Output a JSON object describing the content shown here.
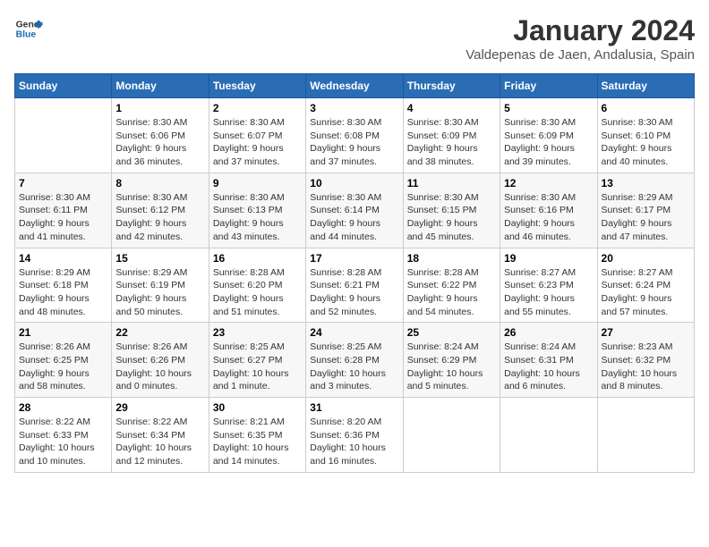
{
  "header": {
    "logo_general": "General",
    "logo_blue": "Blue",
    "month_title": "January 2024",
    "subtitle": "Valdepenas de Jaen, Andalusia, Spain"
  },
  "days_of_week": [
    "Sunday",
    "Monday",
    "Tuesday",
    "Wednesday",
    "Thursday",
    "Friday",
    "Saturday"
  ],
  "weeks": [
    [
      {
        "day": "",
        "content": ""
      },
      {
        "day": "1",
        "content": "Sunrise: 8:30 AM\nSunset: 6:06 PM\nDaylight: 9 hours\nand 36 minutes."
      },
      {
        "day": "2",
        "content": "Sunrise: 8:30 AM\nSunset: 6:07 PM\nDaylight: 9 hours\nand 37 minutes."
      },
      {
        "day": "3",
        "content": "Sunrise: 8:30 AM\nSunset: 6:08 PM\nDaylight: 9 hours\nand 37 minutes."
      },
      {
        "day": "4",
        "content": "Sunrise: 8:30 AM\nSunset: 6:09 PM\nDaylight: 9 hours\nand 38 minutes."
      },
      {
        "day": "5",
        "content": "Sunrise: 8:30 AM\nSunset: 6:09 PM\nDaylight: 9 hours\nand 39 minutes."
      },
      {
        "day": "6",
        "content": "Sunrise: 8:30 AM\nSunset: 6:10 PM\nDaylight: 9 hours\nand 40 minutes."
      }
    ],
    [
      {
        "day": "7",
        "content": ""
      },
      {
        "day": "8",
        "content": "Sunrise: 8:30 AM\nSunset: 6:12 PM\nDaylight: 9 hours\nand 42 minutes."
      },
      {
        "day": "9",
        "content": "Sunrise: 8:30 AM\nSunset: 6:13 PM\nDaylight: 9 hours\nand 43 minutes."
      },
      {
        "day": "10",
        "content": "Sunrise: 8:30 AM\nSunset: 6:14 PM\nDaylight: 9 hours\nand 44 minutes."
      },
      {
        "day": "11",
        "content": "Sunrise: 8:30 AM\nSunset: 6:15 PM\nDaylight: 9 hours\nand 45 minutes."
      },
      {
        "day": "12",
        "content": "Sunrise: 8:30 AM\nSunset: 6:16 PM\nDaylight: 9 hours\nand 46 minutes."
      },
      {
        "day": "13",
        "content": "Sunrise: 8:29 AM\nSunset: 6:17 PM\nDaylight: 9 hours\nand 47 minutes."
      }
    ],
    [
      {
        "day": "14",
        "content": ""
      },
      {
        "day": "15",
        "content": "Sunrise: 8:29 AM\nSunset: 6:19 PM\nDaylight: 9 hours\nand 50 minutes."
      },
      {
        "day": "16",
        "content": "Sunrise: 8:28 AM\nSunset: 6:20 PM\nDaylight: 9 hours\nand 51 minutes."
      },
      {
        "day": "17",
        "content": "Sunrise: 8:28 AM\nSunset: 6:21 PM\nDaylight: 9 hours\nand 52 minutes."
      },
      {
        "day": "18",
        "content": "Sunrise: 8:28 AM\nSunset: 6:22 PM\nDaylight: 9 hours\nand 54 minutes."
      },
      {
        "day": "19",
        "content": "Sunrise: 8:27 AM\nSunset: 6:23 PM\nDaylight: 9 hours\nand 55 minutes."
      },
      {
        "day": "20",
        "content": "Sunrise: 8:27 AM\nSunset: 6:24 PM\nDaylight: 9 hours\nand 57 minutes."
      }
    ],
    [
      {
        "day": "21",
        "content": ""
      },
      {
        "day": "22",
        "content": "Sunrise: 8:26 AM\nSunset: 6:26 PM\nDaylight: 10 hours\nand 0 minutes."
      },
      {
        "day": "23",
        "content": "Sunrise: 8:25 AM\nSunset: 6:27 PM\nDaylight: 10 hours\nand 1 minute."
      },
      {
        "day": "24",
        "content": "Sunrise: 8:25 AM\nSunset: 6:28 PM\nDaylight: 10 hours\nand 3 minutes."
      },
      {
        "day": "25",
        "content": "Sunrise: 8:24 AM\nSunset: 6:29 PM\nDaylight: 10 hours\nand 5 minutes."
      },
      {
        "day": "26",
        "content": "Sunrise: 8:24 AM\nSunset: 6:31 PM\nDaylight: 10 hours\nand 6 minutes."
      },
      {
        "day": "27",
        "content": "Sunrise: 8:23 AM\nSunset: 6:32 PM\nDaylight: 10 hours\nand 8 minutes."
      }
    ],
    [
      {
        "day": "28",
        "content": ""
      },
      {
        "day": "29",
        "content": "Sunrise: 8:22 AM\nSunset: 6:34 PM\nDaylight: 10 hours\nand 12 minutes."
      },
      {
        "day": "30",
        "content": "Sunrise: 8:21 AM\nSunset: 6:35 PM\nDaylight: 10 hours\nand 14 minutes."
      },
      {
        "day": "31",
        "content": "Sunrise: 8:20 AM\nSunset: 6:36 PM\nDaylight: 10 hours\nand 16 minutes."
      },
      {
        "day": "",
        "content": ""
      },
      {
        "day": "",
        "content": ""
      },
      {
        "day": "",
        "content": ""
      }
    ]
  ],
  "week_sunday_content": [
    "Sunrise: 8:30 AM\nSunset: 6:11 PM\nDaylight: 9 hours\nand 41 minutes.",
    "Sunrise: 8:29 AM\nSunset: 6:18 PM\nDaylight: 9 hours\nand 48 minutes.",
    "Sunrise: 8:26 AM\nSunset: 6:25 PM\nDaylight: 9 hours\nand 58 minutes.",
    "Sunrise: 8:22 AM\nSunset: 6:33 PM\nDaylight: 10 hours\nand 10 minutes."
  ]
}
